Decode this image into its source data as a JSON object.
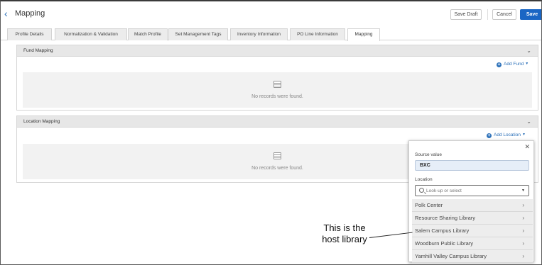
{
  "header": {
    "title": "Mapping",
    "save_draft_label": "Save Draft",
    "cancel_label": "Cancel",
    "save_label": "Save"
  },
  "tabs": [
    {
      "label": "Profile Details"
    },
    {
      "label": "Normalization & Validation"
    },
    {
      "label": "Match Profile"
    },
    {
      "label": "Set Management Tags"
    },
    {
      "label": "Inventory Information"
    },
    {
      "label": "PO Line Information"
    },
    {
      "label": "Mapping",
      "active": true
    }
  ],
  "fund_mapping": {
    "title": "Fund Mapping",
    "add_label": "Add Fund",
    "empty_text": "No records were found."
  },
  "location_mapping": {
    "title": "Location Mapping",
    "add_label": "Add Location",
    "empty_text": "No records were found."
  },
  "popover": {
    "source_label": "Source value",
    "source_value": "BXC",
    "location_label": "Location",
    "location_placeholder": "Look-up or select",
    "options": [
      "Polk Center",
      "Resource Sharing Library",
      "Salem Campus Library",
      "Woodburn Public Library",
      "Yamhill Valley Campus Library"
    ]
  },
  "annotation": {
    "line1": "This is the",
    "line2": "host library"
  },
  "colors": {
    "accent": "#1a66c4",
    "link": "#2a6fb8",
    "panel_header": "#e7e7e7"
  }
}
